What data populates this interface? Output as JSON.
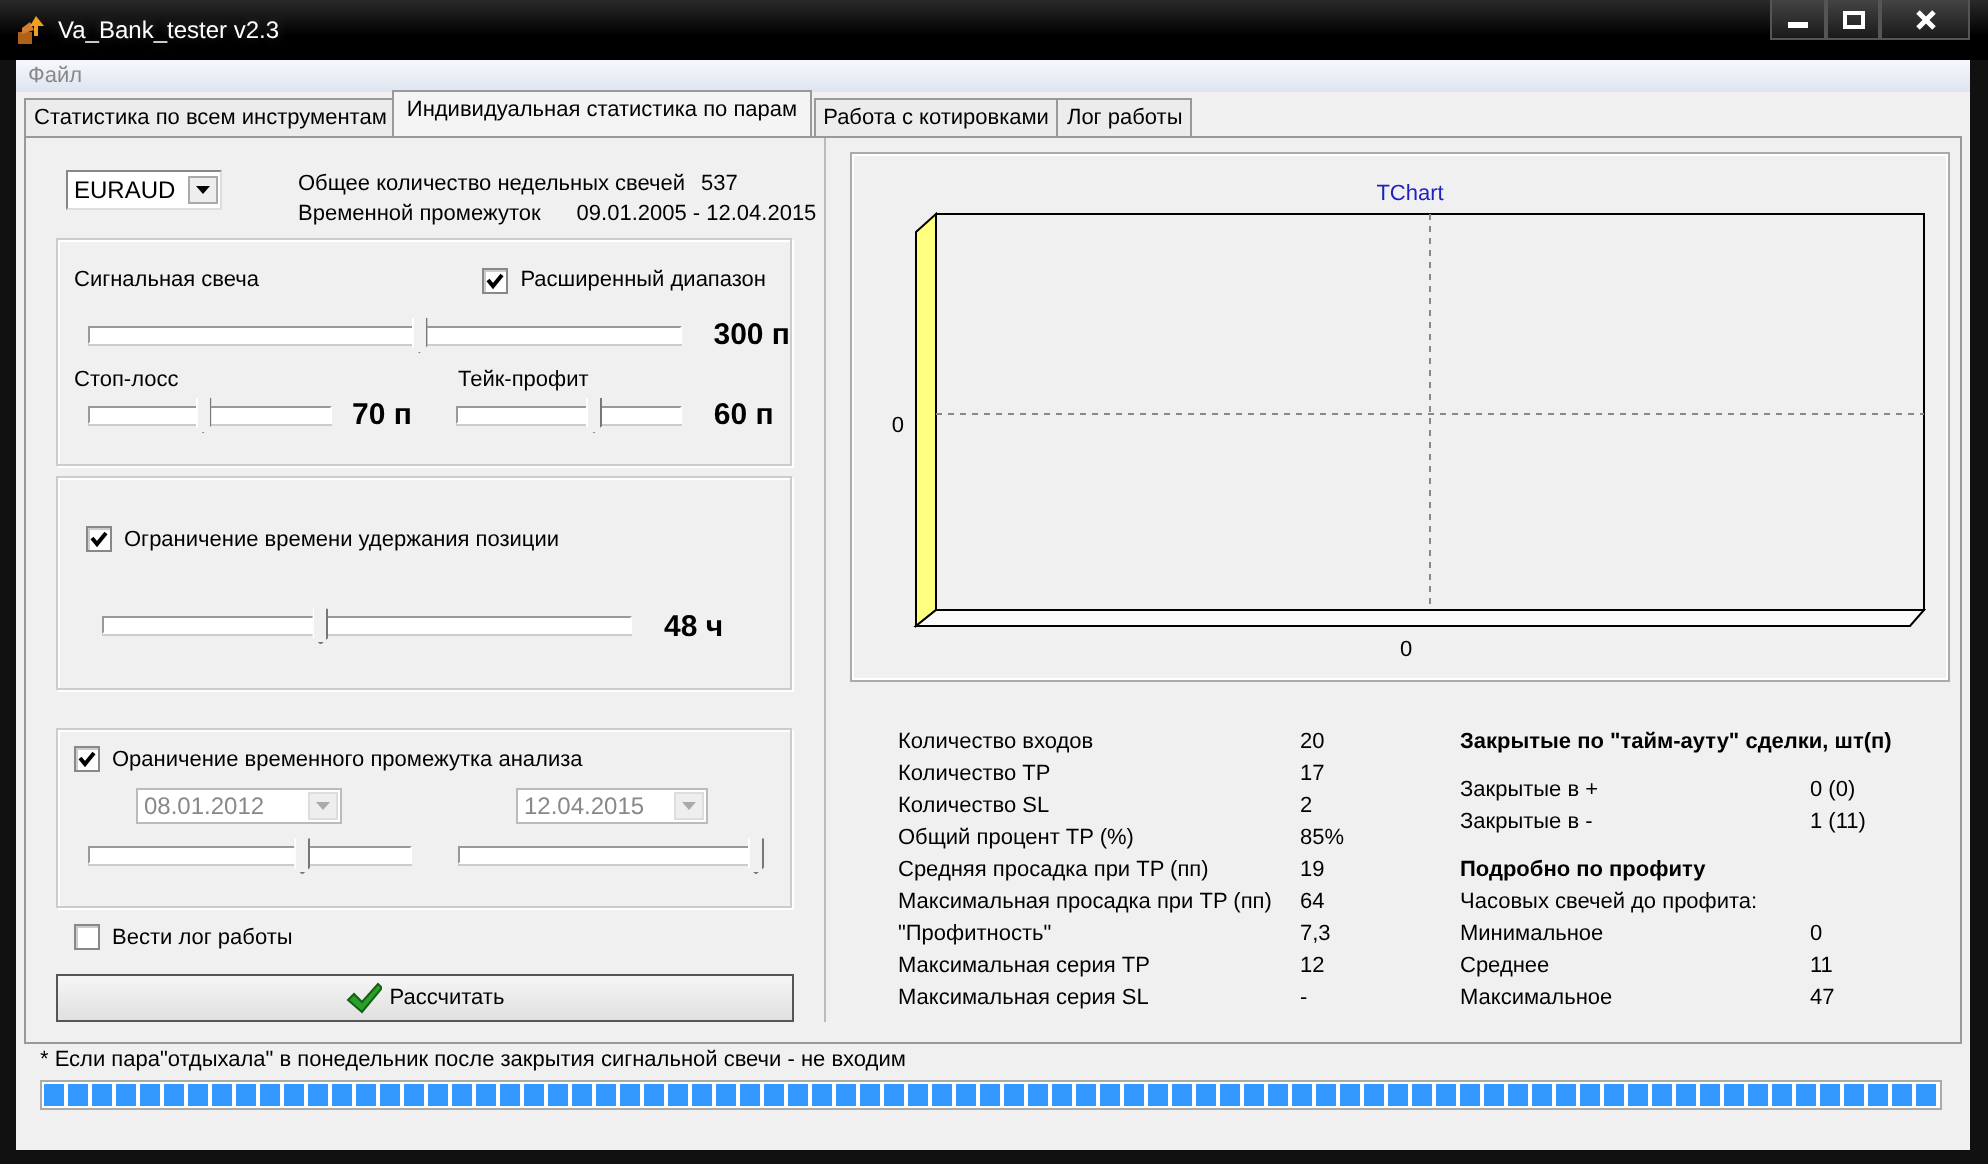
{
  "window": {
    "title": "Va_Bank_tester v2.3"
  },
  "menu": [
    {
      "label": "Файл",
      "disabled": true
    }
  ],
  "tabs": [
    {
      "label": "Статистика по всем инструментам",
      "selected": false
    },
    {
      "label": "Индивидуальная статистика по парам",
      "selected": true
    },
    {
      "label": "Работа с котировками",
      "selected": false
    },
    {
      "label": "Лог работы",
      "selected": false
    }
  ],
  "pair": {
    "value": "EURAUD"
  },
  "summary": [
    {
      "label": "Общее количество недельных свечей",
      "value": "537"
    },
    {
      "label": "Временной промежуток",
      "value": "09.01.2005 - 12.04.2015"
    }
  ],
  "signal_group": {
    "label": "Сигнальная свеча",
    "extended_range": {
      "label": "Расширенный диапазон",
      "checked": true
    },
    "slider": {
      "level": 0.56,
      "reading": "300 п"
    },
    "stop_loss": {
      "label": "Стоп-лосс",
      "level": 0.47,
      "reading": "70 п"
    },
    "take_profit": {
      "label": "Тейк-профит",
      "level": 0.62,
      "reading": "60 п"
    }
  },
  "hold_group": {
    "checkbox": {
      "label": "Ограничение времени удержания позиции",
      "checked": true
    },
    "slider": {
      "level": 0.41,
      "reading": "48 ч"
    }
  },
  "period_group": {
    "checkbox": {
      "label": "Ораничение временного промежутка анализа",
      "checked": true
    },
    "start": {
      "value": "08.01.2012",
      "disabled": true,
      "level": 0.67
    },
    "end": {
      "value": "12.04.2015",
      "disabled": true,
      "level": 1
    }
  },
  "log_checkbox": {
    "label": "Вести лог работы",
    "checked": false
  },
  "calculate_button": {
    "label": "Рассчитать"
  },
  "chart": {
    "title": "TChart",
    "y_tick": "0",
    "x_tick": "0"
  },
  "stats": [
    {
      "label": "Количество входов",
      "value": "20"
    },
    {
      "label": "Количество TP",
      "value": "17"
    },
    {
      "label": "Количество SL",
      "value": "2"
    },
    {
      "label": "Общий процент TP   (%)",
      "value": "85%"
    },
    {
      "label": "Средняя просадка при TP (пп)",
      "value": "19"
    },
    {
      "label": "Максимальная просадка при TP (пп)",
      "value": "64"
    },
    {
      "label": "\"Профитность\"",
      "value": "7,3"
    },
    {
      "label": "Максимальная серия TP",
      "value": "12"
    },
    {
      "label": "Максимальная серия SL",
      "value": "-"
    }
  ],
  "timeout": {
    "title": "Закрытые по \"тайм-ауту\" сделки, шт(п)",
    "rows": [
      {
        "label": "Закрытые в +",
        "value": "0 (0)"
      },
      {
        "label": "Закрытые в -",
        "value": "1 (11)"
      }
    ]
  },
  "profit": {
    "title": "Подробно по профиту",
    "subtitle": "Часовых свечей до профита:",
    "rows": [
      {
        "label": "Минимальное",
        "value": "0"
      },
      {
        "label": "Среднее",
        "value": "11"
      },
      {
        "label": "Максимальное",
        "value": "47"
      }
    ]
  },
  "footnote": "* Если пара\"отдыхала\" в понедельник после закрытия сигнальной свечи - не входим",
  "progress": {
    "level": 1
  }
}
